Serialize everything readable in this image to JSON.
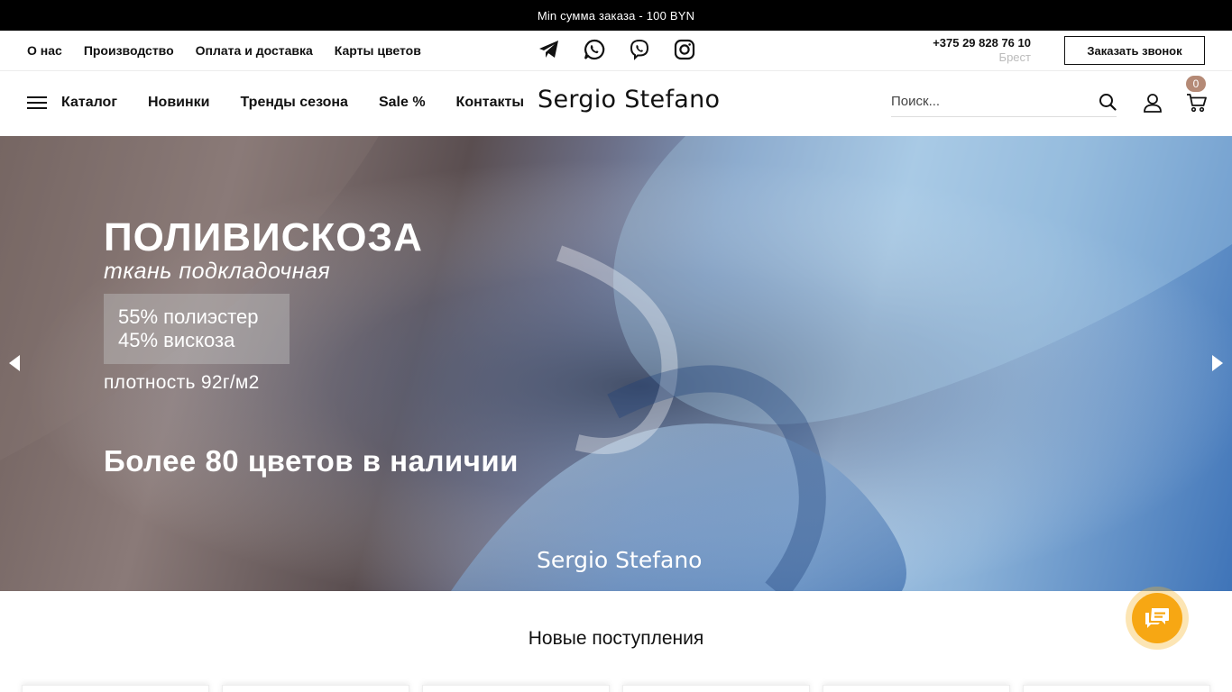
{
  "topbar": {
    "text": "Min сумма заказа - 100 BYN",
    "bg_color": "#000000"
  },
  "utility_nav": {
    "links": [
      {
        "label": "О нас"
      },
      {
        "label": "Производство"
      },
      {
        "label": "Оплата и доставка"
      },
      {
        "label": "Карты цветов"
      }
    ],
    "socials": [
      "telegram-icon",
      "whatsapp-icon",
      "viber-icon",
      "instagram-icon"
    ],
    "phone": "+375 29 828 76 10",
    "city": "Брест",
    "callback_label": "Заказать звонок"
  },
  "main_nav": {
    "menu_icon": "hamburger-icon",
    "links": [
      {
        "label": "Каталог"
      },
      {
        "label": "Новинки"
      },
      {
        "label": "Тренды сезона"
      },
      {
        "label": "Sale %"
      },
      {
        "label": "Контакты"
      }
    ],
    "logo": "Sergio Stefano",
    "search": {
      "placeholder": "Поиск..."
    },
    "cart_count": "0",
    "badge_color": "#b58a76"
  },
  "hero": {
    "title": "ПОЛИВИСКОЗА",
    "subtitle": "ткань подкладочная",
    "composition": [
      "55% полиэстер",
      "45% вискоза"
    ],
    "density": "плотность 92г/м2",
    "tagline": "Более 80 цветов в наличии",
    "brand": "Sergio Stefano"
  },
  "section": {
    "title": "Новые поступления"
  },
  "chat": {
    "icon": "chat-icon",
    "color": "#f7a713"
  }
}
